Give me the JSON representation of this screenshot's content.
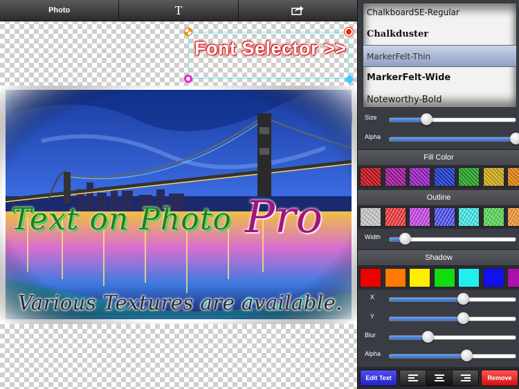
{
  "toolbar": {
    "photo_label": "Photo",
    "text_label": "T",
    "share_icon": "share-icon"
  },
  "canvas": {
    "selected_text": "Font Selector >>",
    "photo_text_1": "Text on Photo",
    "photo_text_2": "Pro",
    "photo_text_3": "Various Textures are available."
  },
  "fonts": {
    "items": [
      "ChalkboardSE-Regular",
      "Chalkduster",
      "MarkerFelt-Thin",
      "MarkerFelt-Wide",
      "Noteworthy-Bold"
    ],
    "selected": "MarkerFelt-Thin"
  },
  "controls": {
    "size_label": "Size",
    "size_value": 0.29,
    "alpha_label": "Alpha",
    "alpha_value": 1.0,
    "fill_color_header": "Fill Color",
    "fill_colors": [
      "#c8101c",
      "#a4149e",
      "#9a20c6",
      "#1a3ad0",
      "#26a626",
      "#d4b018",
      "#e8840e"
    ],
    "outline_header": "Outline",
    "outline_colors": [
      "#c0c0c0",
      "#e83636",
      "#c040e0",
      "#4a4ae6",
      "#40e0e0",
      "#52d052",
      "#e89030"
    ],
    "width_label": "Width",
    "width_value": 0.12,
    "shadow_header": "Shadow",
    "shadow_colors": [
      "#ee0000",
      "#ff7a00",
      "#ffee00",
      "#11dd11",
      "#22eeee",
      "#1111ee",
      "#aa11aa"
    ],
    "x_label": "X",
    "x_value": 0.58,
    "y_label": "Y",
    "y_value": 0.58,
    "blur_label": "Blur",
    "blur_value": 0.3,
    "shadow_alpha_label": "Alpha",
    "shadow_alpha_value": 0.61
  },
  "bottom": {
    "edit_text_label": "Edit Text",
    "remove_label": "Remove"
  }
}
